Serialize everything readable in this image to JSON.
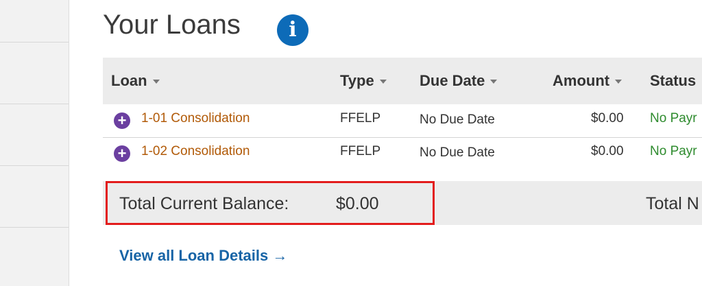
{
  "page": {
    "title": "Your Loans",
    "info_icon_glyph": "i"
  },
  "table": {
    "headers": [
      "Loan",
      "Type",
      "Due Date",
      "Amount",
      "Status"
    ],
    "rows": [
      {
        "loan": "1-01 Consolidation",
        "type": "FFELP",
        "due_date": "No Due Date",
        "amount": "$0.00",
        "status": "No Payr"
      },
      {
        "loan": "1-02 Consolidation",
        "type": "FFELP",
        "due_date": "No Due Date",
        "amount": "$0.00",
        "status": "No Payr"
      }
    ],
    "expand_glyph": "+"
  },
  "totals": {
    "balance_label": "Total Current Balance:",
    "balance_value": "$0.00",
    "right_label": "Total N"
  },
  "links": {
    "view_details": "View all Loan Details",
    "arrow_glyph": "→"
  },
  "colors": {
    "accent_blue": "#0d6bb8",
    "link_orange": "#b15a08",
    "status_green": "#2e8b2e",
    "expand_purple": "#6b3fa0",
    "highlight_red": "#e31c1c"
  }
}
